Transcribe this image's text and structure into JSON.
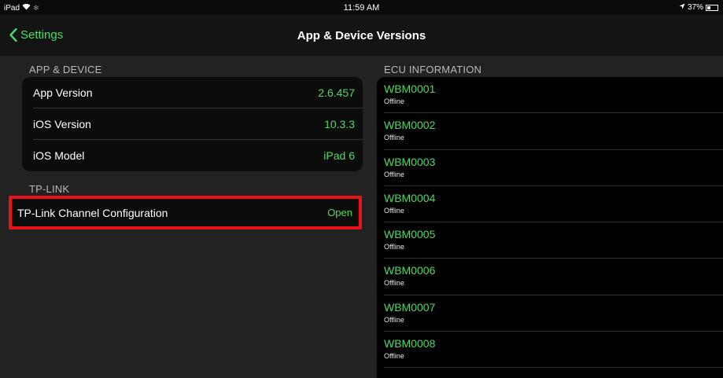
{
  "status_bar": {
    "device": "iPad",
    "time": "11:59 AM",
    "battery": "37%",
    "battery_level": 0.37
  },
  "nav": {
    "back_label": "Settings",
    "title": "App & Device Versions"
  },
  "app_device": {
    "header": "APP & DEVICE",
    "rows": [
      {
        "label": "App Version",
        "value": "2.6.457"
      },
      {
        "label": "iOS Version",
        "value": "10.3.3"
      },
      {
        "label": "iOS Model",
        "value": "iPad 6"
      }
    ]
  },
  "tp_link": {
    "header": "TP-LINK",
    "row": {
      "label": "TP-Link Channel Configuration",
      "value": "Open"
    }
  },
  "ecu": {
    "header": "ECU INFORMATION",
    "items": [
      {
        "name": "WBM0001",
        "status": "Offline"
      },
      {
        "name": "WBM0002",
        "status": "Offline"
      },
      {
        "name": "WBM0003",
        "status": "Offline"
      },
      {
        "name": "WBM0004",
        "status": "Offline"
      },
      {
        "name": "WBM0005",
        "status": "Offline"
      },
      {
        "name": "WBM0006",
        "status": "Offline"
      },
      {
        "name": "WBM0007",
        "status": "Offline"
      },
      {
        "name": "WBM0008",
        "status": "Offline"
      }
    ]
  },
  "colors": {
    "accent": "#4cd964",
    "highlight": "#e8121a",
    "background": "#222222"
  }
}
